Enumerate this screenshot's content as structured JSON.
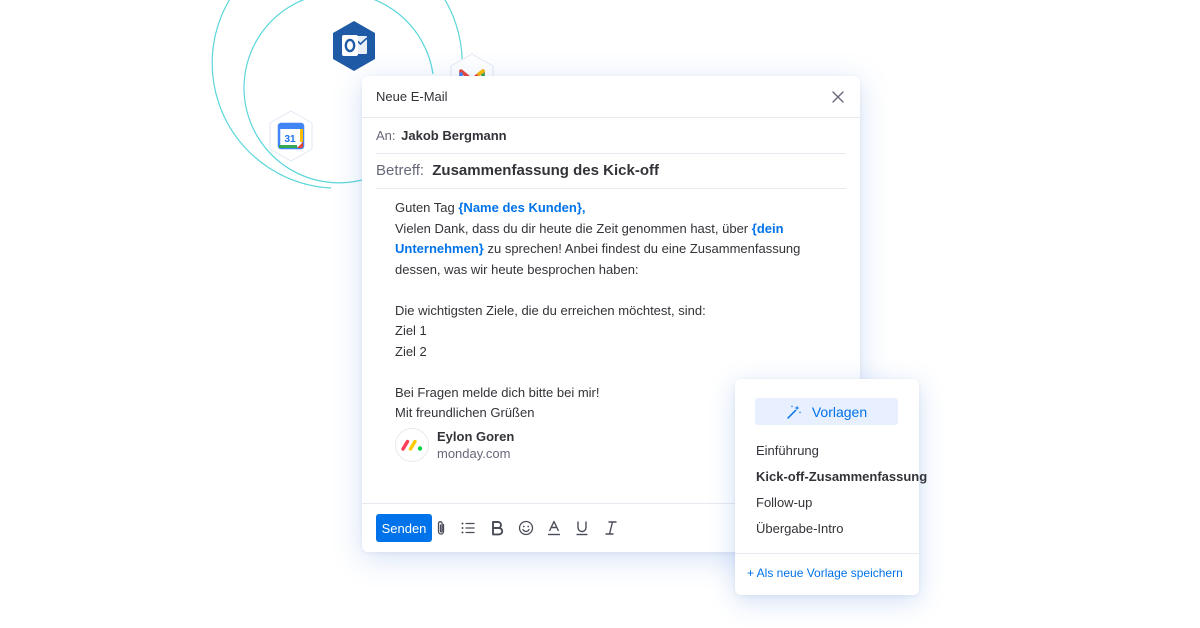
{
  "window": {
    "title": "Neue E-Mail"
  },
  "recipient": {
    "label": "An:",
    "name": "Jakob Bergmann"
  },
  "subject": {
    "label": "Betreff:",
    "value": "Zusammenfassung des Kick-off"
  },
  "body": {
    "greeting": "Guten Tag ",
    "placeholder_customer": "{Name des Kunden}",
    "greeting_end": ",",
    "line2_start": "Vielen Dank, dass du dir heute die Zeit genommen hast, über ",
    "placeholder_company_1": "{dein",
    "placeholder_company_2": "Unternehmen}",
    "line3_rest": " zu sprechen! Anbei findest du eine Zusammenfassung",
    "line4": "dessen, was wir heute besprochen haben:",
    "goals_intro": "Die wichtigsten Ziele, die du erreichen möchtest, sind:",
    "goal_1": "Ziel 1",
    "goal_2": "Ziel 2",
    "closing_1": "Bei Fragen melde dich bitte bei mir!",
    "closing_2": "Mit freundlichen Grüßen"
  },
  "signature": {
    "name": "Eylon Goren",
    "domain": "monday.com"
  },
  "toolbar": {
    "send_label": "Senden",
    "tools": [
      "paperclip-icon",
      "list-icon",
      "bold-icon",
      "emoji-icon",
      "text-color-icon",
      "underline-icon",
      "italic-icon"
    ]
  },
  "templates": {
    "button_label": "Vorlagen",
    "items": [
      {
        "label": "Einführung",
        "active": false
      },
      {
        "label": "Kick-off-Zusammenfassung",
        "active": true
      },
      {
        "label": "Follow-up",
        "active": false
      },
      {
        "label": "Übergabe-Intro",
        "active": false
      }
    ],
    "save_label": "+ Als neue Vorlage speichern"
  },
  "integrations": {
    "outlook_icon": "outlook-icon",
    "gmail_icon": "gmail-icon",
    "calendar_icon": "google-calendar-icon",
    "calendar_day": "31"
  },
  "colors": {
    "accent": "#0073ea",
    "orbit": "#3ecfd4",
    "text": "#323338",
    "muted": "#676879"
  }
}
